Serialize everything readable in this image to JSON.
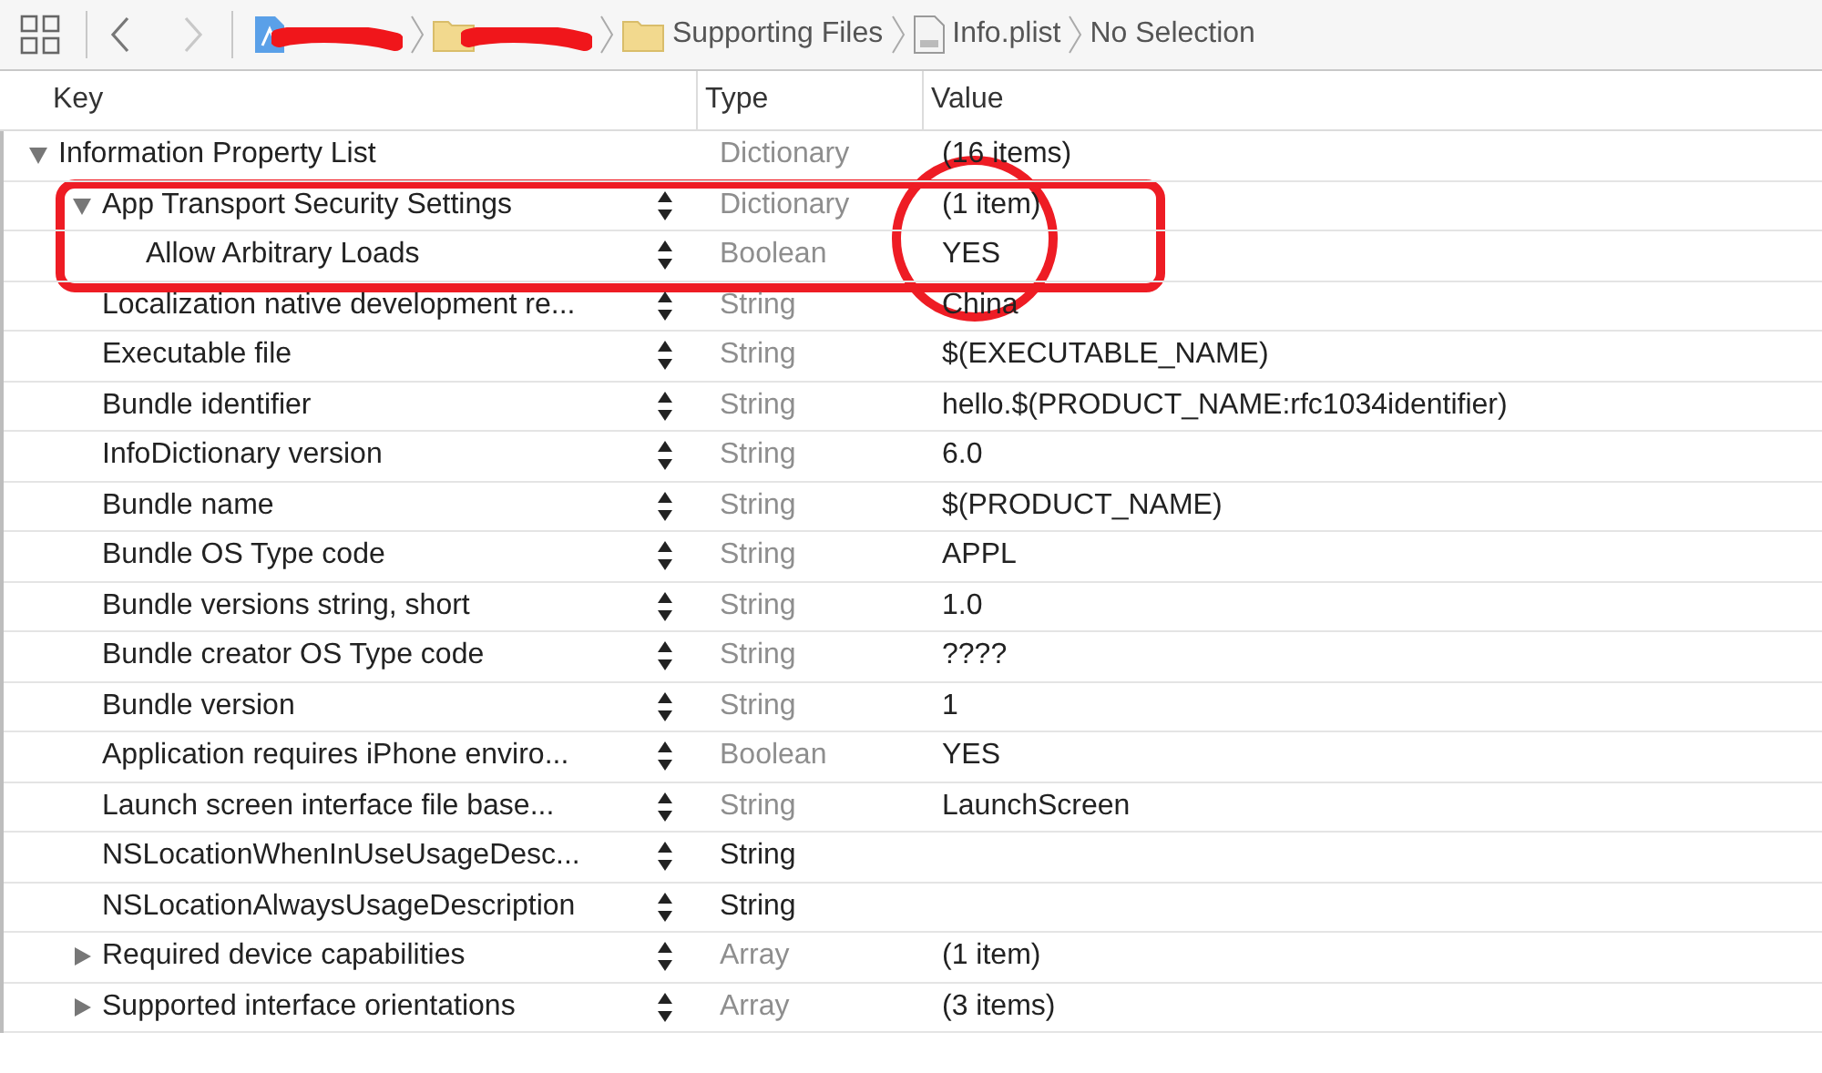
{
  "breadcrumbs": [
    {
      "kind": "project",
      "redacted": true
    },
    {
      "kind": "folder",
      "redacted": true
    },
    {
      "kind": "folder",
      "label": "Supporting Files"
    },
    {
      "kind": "file",
      "label": "Info.plist"
    },
    {
      "kind": "text",
      "label": "No Selection"
    }
  ],
  "nav": {
    "back_disabled": false,
    "forward_disabled": true
  },
  "table": {
    "columns": [
      "Key",
      "Type",
      "Value"
    ],
    "rows": [
      {
        "key": "Information Property List",
        "type": "Dictionary",
        "value": "(16 items)",
        "dimmed": true,
        "expanded": true,
        "children": [
          {
            "key": "App Transport Security Settings",
            "type": "Dictionary",
            "value": "(1 item)",
            "dimmed": true,
            "expanded": true,
            "children": [
              {
                "key": "Allow Arbitrary Loads",
                "type": "Boolean",
                "value": "YES",
                "dimmed": true
              }
            ]
          },
          {
            "key": "Localization native development re...",
            "type": "String",
            "value": "China",
            "dimmed": true
          },
          {
            "key": "Executable file",
            "type": "String",
            "value": "$(EXECUTABLE_NAME)",
            "dimmed": true
          },
          {
            "key": "Bundle identifier",
            "type": "String",
            "value": "hello.$(PRODUCT_NAME:rfc1034identifier)",
            "dimmed": true
          },
          {
            "key": "InfoDictionary version",
            "type": "String",
            "value": "6.0",
            "dimmed": true
          },
          {
            "key": "Bundle name",
            "type": "String",
            "value": "$(PRODUCT_NAME)",
            "dimmed": true
          },
          {
            "key": "Bundle OS Type code",
            "type": "String",
            "value": "APPL",
            "dimmed": true
          },
          {
            "key": "Bundle versions string, short",
            "type": "String",
            "value": "1.0",
            "dimmed": true
          },
          {
            "key": "Bundle creator OS Type code",
            "type": "String",
            "value": "????",
            "dimmed": true
          },
          {
            "key": "Bundle version",
            "type": "String",
            "value": "1",
            "dimmed": true
          },
          {
            "key": "Application requires iPhone enviro...",
            "type": "Boolean",
            "value": "YES",
            "dimmed": true
          },
          {
            "key": "Launch screen interface file base...",
            "type": "String",
            "value": "LaunchScreen",
            "dimmed": true
          },
          {
            "key": "NSLocationWhenInUseUsageDesc...",
            "type": "String",
            "dimmed": false
          },
          {
            "key": "NSLocationAlwaysUsageDescription",
            "type": "String",
            "dimmed": false
          },
          {
            "key": "Required device capabilities",
            "type": "Array",
            "value": "(1 item)",
            "dimmed": true,
            "expanded": false
          },
          {
            "key": "Supported interface orientations",
            "type": "Array",
            "value": "(3 items)",
            "dimmed": true,
            "expanded": false
          }
        ]
      }
    ]
  },
  "annotation_box": true,
  "annotation_circle": true
}
